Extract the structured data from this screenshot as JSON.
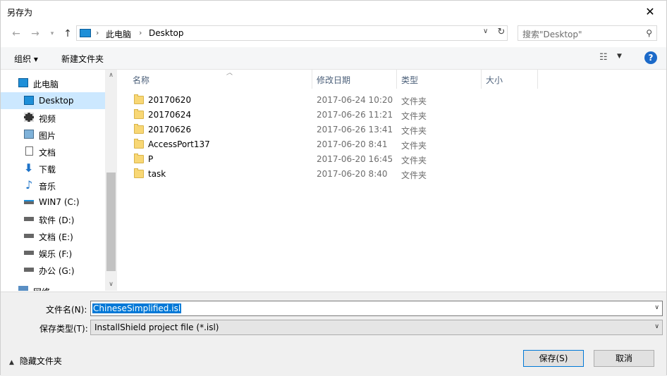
{
  "window": {
    "title": "另存为",
    "close_glyph": "✕"
  },
  "address": {
    "crumbs": [
      "此电脑",
      "Desktop"
    ],
    "search_placeholder": "搜索\"Desktop\""
  },
  "toolbar": {
    "organize": "组织 ▾",
    "new_folder": "新建文件夹",
    "help": "?"
  },
  "nav": {
    "items": [
      {
        "label": "此电脑",
        "icon": "computer-icon"
      },
      {
        "label": "Desktop",
        "icon": "desktop-icon",
        "selected": true
      },
      {
        "label": "视频",
        "icon": "video-icon"
      },
      {
        "label": "图片",
        "icon": "pictures-icon"
      },
      {
        "label": "文档",
        "icon": "documents-icon"
      },
      {
        "label": "下载",
        "icon": "download-icon"
      },
      {
        "label": "音乐",
        "icon": "music-icon"
      },
      {
        "label": "WIN7 (C:)",
        "icon": "system-drive-icon"
      },
      {
        "label": "软件 (D:)",
        "icon": "drive-icon"
      },
      {
        "label": "文档 (E:)",
        "icon": "drive-icon"
      },
      {
        "label": "娱乐 (F:)",
        "icon": "drive-icon"
      },
      {
        "label": "办公 (G:)",
        "icon": "drive-icon"
      },
      {
        "label": "网络",
        "icon": "network-icon"
      }
    ]
  },
  "columns": {
    "name": "名称",
    "date": "修改日期",
    "type": "类型",
    "size": "大小"
  },
  "files": [
    {
      "name": "20170620",
      "date": "2017-06-24 10:20",
      "type": "文件夹"
    },
    {
      "name": "20170624",
      "date": "2017-06-26 11:21",
      "type": "文件夹"
    },
    {
      "name": "20170626",
      "date": "2017-06-26 13:41",
      "type": "文件夹"
    },
    {
      "name": "AccessPort137",
      "date": "2017-06-20 8:41",
      "type": "文件夹"
    },
    {
      "name": "P",
      "date": "2017-06-20 16:45",
      "type": "文件夹"
    },
    {
      "name": "task",
      "date": "2017-06-20 8:40",
      "type": "文件夹"
    }
  ],
  "bottom": {
    "filename_label": "文件名(N):",
    "filename_value": "ChineseSimplified.isl",
    "filetype_label": "保存类型(T):",
    "filetype_value": "InstallShield project file (*.isl)",
    "hide_folders": "隐藏文件夹",
    "save": "保存(S)",
    "cancel": "取消"
  }
}
